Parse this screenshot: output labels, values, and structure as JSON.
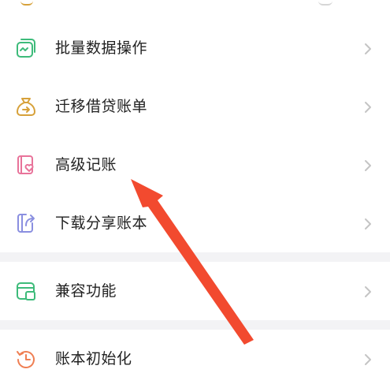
{
  "menu": {
    "items": [
      {
        "label": "批量数据操作",
        "icon": "batch-data-icon"
      },
      {
        "label": "迁移借贷账单",
        "icon": "money-bag-icon"
      },
      {
        "label": "高级记账",
        "icon": "advanced-book-icon"
      },
      {
        "label": "下载分享账本",
        "icon": "share-export-icon"
      },
      {
        "label": "兼容功能",
        "icon": "compatible-window-icon"
      },
      {
        "label": "账本初始化",
        "icon": "reset-clock-icon"
      }
    ]
  },
  "colors": {
    "green": "#3dbb7a",
    "gold": "#d7a13a",
    "pink": "#e8739a",
    "violet": "#8a8fe0",
    "orange": "#ef7f53",
    "arrow": "#f24a2f",
    "chevron": "#c4c4c4"
  }
}
